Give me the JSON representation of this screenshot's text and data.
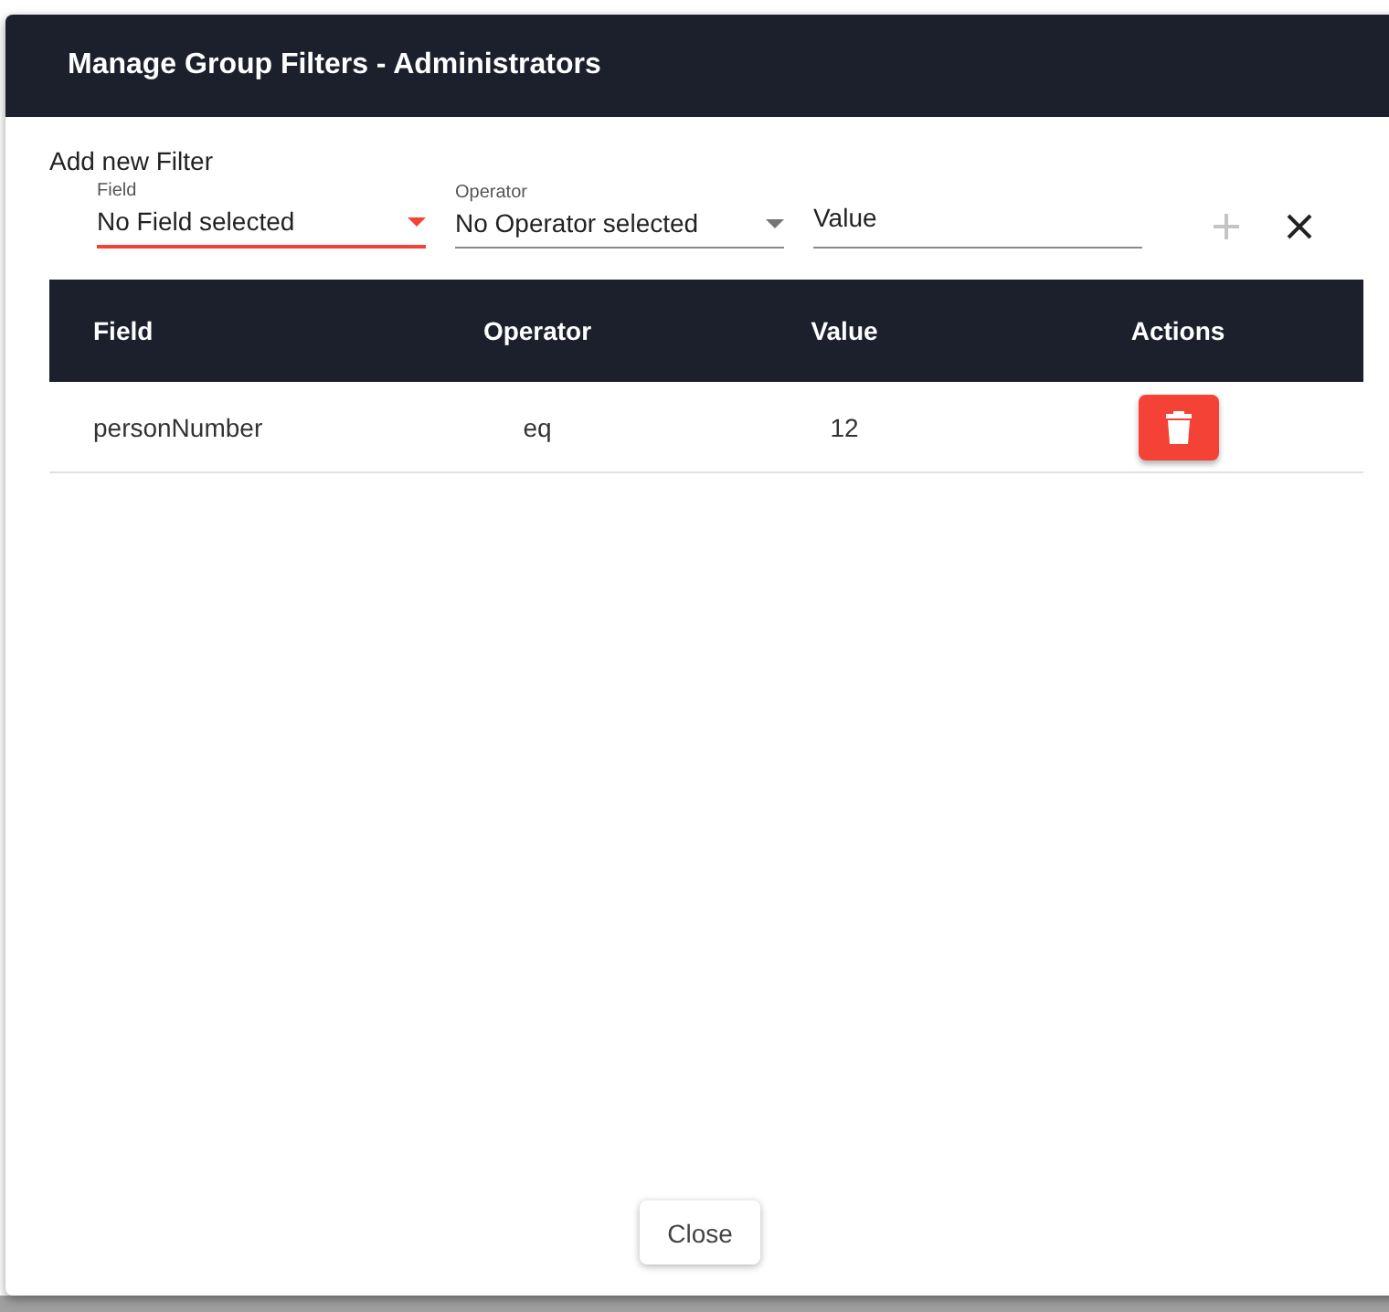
{
  "dialog": {
    "title": "Manage Group Filters - Administrators"
  },
  "new_filter": {
    "heading": "Add new Filter",
    "selects": [
      {
        "label": "Field",
        "value": "No Field selected",
        "error": true
      },
      {
        "label": "Operator",
        "value": "No Operator selected",
        "error": false
      }
    ],
    "value_field": {
      "placeholder": "Value"
    },
    "add_button": {
      "disabled": true
    }
  },
  "table": {
    "columns": [
      "Field",
      "Operator",
      "Value",
      "Actions"
    ],
    "rows": [
      {
        "field": "personNumber",
        "operator": "eq",
        "value": "12"
      }
    ]
  },
  "buttons": [
    "Close"
  ]
}
